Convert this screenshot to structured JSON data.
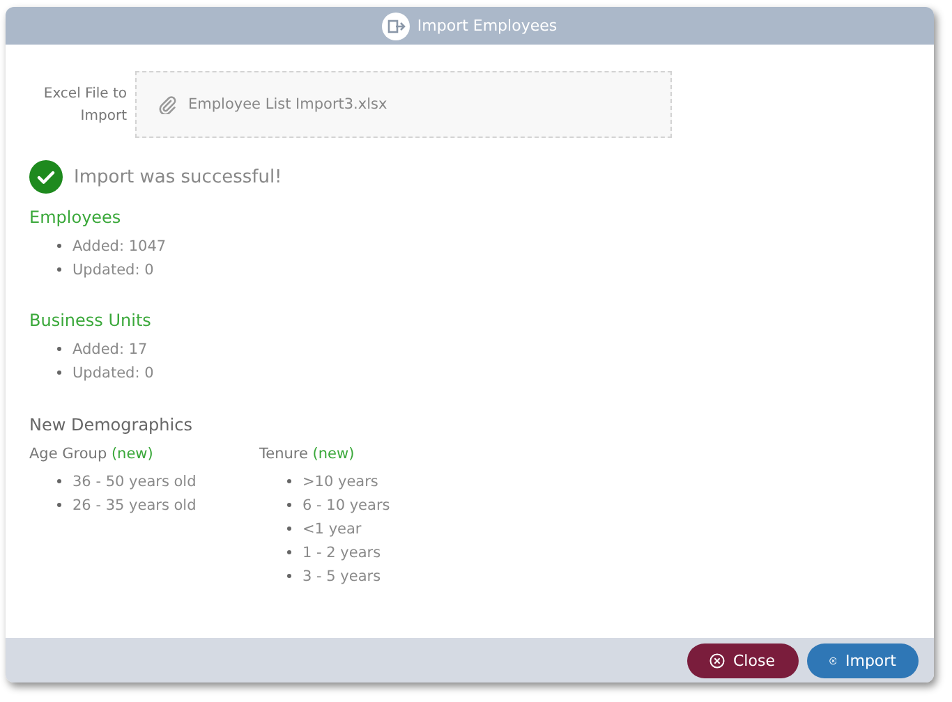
{
  "window": {
    "title": "Import Employees"
  },
  "file_field": {
    "label": "Excel File to Import",
    "value": "Employee List Import3.xlsx"
  },
  "status": {
    "message": "Import was successful!"
  },
  "sections": [
    {
      "title": "Employees",
      "items": [
        "Added: 1047",
        "Updated: 0"
      ]
    },
    {
      "title": "Business Units",
      "items": [
        "Added: 17",
        "Updated: 0"
      ]
    }
  ],
  "demographics": {
    "title": "New Demographics",
    "groups": [
      {
        "label": "Age Group",
        "tag": "(new)",
        "items": [
          "36 - 50 years old",
          "26 - 35 years old"
        ]
      },
      {
        "label": "Tenure",
        "tag": "(new)",
        "items": [
          ">10 years",
          "6 - 10 years",
          "<1 year",
          "1 - 2 years",
          "3 - 5 years"
        ]
      }
    ]
  },
  "buttons": [
    {
      "label": "Close",
      "kind": "close"
    },
    {
      "label": "Import",
      "kind": "import"
    }
  ]
}
